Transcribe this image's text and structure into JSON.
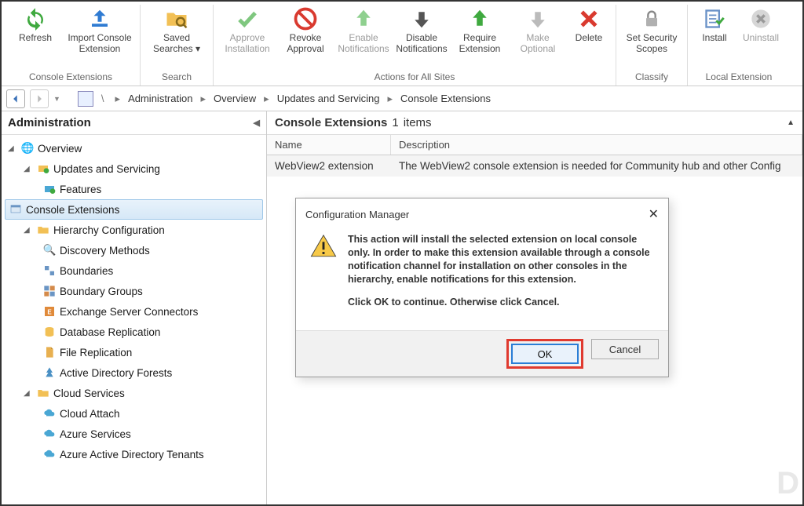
{
  "ribbon": {
    "groups": [
      {
        "label": "Console Extensions",
        "buttons": [
          {
            "id": "refresh",
            "label": "Refresh",
            "disabled": false
          },
          {
            "id": "import",
            "label": "Import Console Extension",
            "disabled": false
          }
        ]
      },
      {
        "label": "Search",
        "buttons": [
          {
            "id": "saved-searches",
            "label": "Saved Searches ▾",
            "disabled": false
          }
        ]
      },
      {
        "label": "Actions for All Sites",
        "buttons": [
          {
            "id": "approve",
            "label": "Approve Installation",
            "disabled": true
          },
          {
            "id": "revoke",
            "label": "Revoke Approval",
            "disabled": false
          },
          {
            "id": "enable-notif",
            "label": "Enable Notifications",
            "disabled": true
          },
          {
            "id": "disable-notif",
            "label": "Disable Notifications",
            "disabled": false
          },
          {
            "id": "require",
            "label": "Require Extension",
            "disabled": false
          },
          {
            "id": "optional",
            "label": "Make Optional",
            "disabled": true
          },
          {
            "id": "delete",
            "label": "Delete",
            "disabled": false
          }
        ]
      },
      {
        "label": "Classify",
        "buttons": [
          {
            "id": "scopes",
            "label": "Set Security Scopes",
            "disabled": false
          }
        ]
      },
      {
        "label": "Local Extension",
        "buttons": [
          {
            "id": "install",
            "label": "Install",
            "disabled": false
          },
          {
            "id": "uninstall",
            "label": "Uninstall",
            "disabled": true
          }
        ]
      }
    ]
  },
  "breadcrumb": {
    "root_sep": "\\",
    "items": [
      "Administration",
      "Overview",
      "Updates and Servicing",
      "Console Extensions"
    ]
  },
  "sidebar": {
    "title": "Administration",
    "tree": [
      {
        "label": "Overview",
        "level": 0,
        "expanded": true,
        "icon": "globe"
      },
      {
        "label": "Updates and Servicing",
        "level": 1,
        "expanded": true,
        "icon": "update"
      },
      {
        "label": "Features",
        "level": 2,
        "icon": "feature"
      },
      {
        "label": "Console Extensions",
        "level": 2,
        "icon": "console",
        "selected": true
      },
      {
        "label": "Hierarchy Configuration",
        "level": 1,
        "expanded": true,
        "icon": "folder"
      },
      {
        "label": "Discovery Methods",
        "level": 2,
        "icon": "discovery"
      },
      {
        "label": "Boundaries",
        "level": 2,
        "icon": "boundaries"
      },
      {
        "label": "Boundary Groups",
        "level": 2,
        "icon": "groups"
      },
      {
        "label": "Exchange Server Connectors",
        "level": 2,
        "icon": "exchange"
      },
      {
        "label": "Database Replication",
        "level": 2,
        "icon": "db"
      },
      {
        "label": "File Replication",
        "level": 2,
        "icon": "file"
      },
      {
        "label": "Active Directory Forests",
        "level": 2,
        "icon": "ad"
      },
      {
        "label": "Cloud Services",
        "level": 1,
        "expanded": true,
        "icon": "folder"
      },
      {
        "label": "Cloud Attach",
        "level": 2,
        "icon": "cloud-attach"
      },
      {
        "label": "Azure Services",
        "level": 2,
        "icon": "azure"
      },
      {
        "label": "Azure Active Directory Tenants",
        "level": 2,
        "icon": "aad"
      }
    ]
  },
  "content": {
    "title_prefix": "Console Extensions",
    "count": "1",
    "count_suffix": "items",
    "columns": {
      "name": "Name",
      "desc": "Description"
    },
    "rows": [
      {
        "name": "WebView2 extension",
        "desc": "The WebView2 console extension is needed for Community hub and other Config"
      }
    ]
  },
  "dialog": {
    "title": "Configuration Manager",
    "body_main": "This action will install the selected extension on local console only. In order to make this extension available through a console notification channel for installation on other consoles in the hierarchy, enable notifications for this extension.",
    "body_action": "Click OK to continue. Otherwise click Cancel.",
    "ok": "OK",
    "cancel": "Cancel"
  },
  "watermark": "D"
}
